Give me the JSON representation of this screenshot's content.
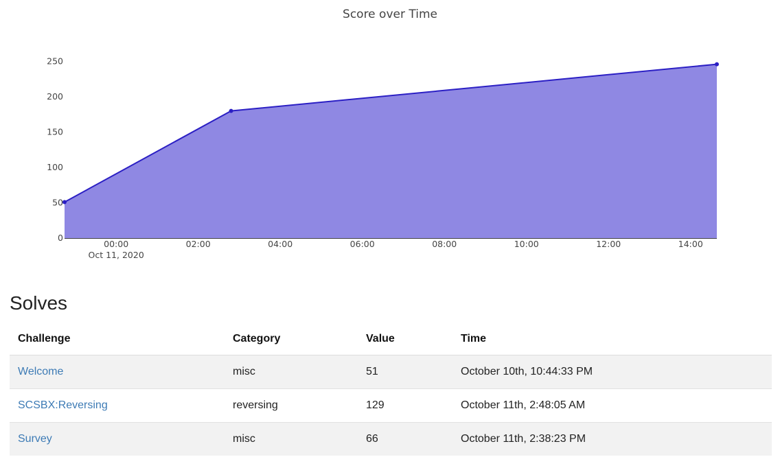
{
  "chart_data": {
    "type": "area",
    "title": "Score over Time",
    "xlabel": "",
    "ylabel": "",
    "x_axis": "time",
    "x": [
      "2020-10-10 22:44:33",
      "2020-10-11 02:48:05",
      "2020-10-11 14:38:23"
    ],
    "y": [
      51,
      180,
      246
    ],
    "xlim": [
      "2020-10-10 22:44:33",
      "2020-10-11 14:38:23"
    ],
    "ylim": [
      0,
      260
    ],
    "yticks": [
      0,
      50,
      100,
      150,
      200,
      250
    ],
    "xticks": [
      {
        "value": "2020-10-11 00:00",
        "label": "00:00",
        "sublabel": "Oct 11, 2020"
      },
      {
        "value": "2020-10-11 02:00",
        "label": "02:00",
        "sublabel": ""
      },
      {
        "value": "2020-10-11 04:00",
        "label": "04:00",
        "sublabel": ""
      },
      {
        "value": "2020-10-11 06:00",
        "label": "06:00",
        "sublabel": ""
      },
      {
        "value": "2020-10-11 08:00",
        "label": "08:00",
        "sublabel": ""
      },
      {
        "value": "2020-10-11 10:00",
        "label": "10:00",
        "sublabel": ""
      },
      {
        "value": "2020-10-11 12:00",
        "label": "12:00",
        "sublabel": ""
      },
      {
        "value": "2020-10-11 14:00",
        "label": "14:00",
        "sublabel": ""
      }
    ],
    "grid": false,
    "legend": "none",
    "line_color": "#2b1fc4",
    "fill_color": "#8f88e3"
  },
  "solves": {
    "heading": "Solves",
    "columns": [
      "Challenge",
      "Category",
      "Value",
      "Time"
    ],
    "rows": [
      {
        "challenge": "Welcome",
        "category": "misc",
        "value": "51",
        "time": "October 10th, 10:44:33 PM"
      },
      {
        "challenge": "SCSBX:Reversing",
        "category": "reversing",
        "value": "129",
        "time": "October 11th, 2:48:05 AM"
      },
      {
        "challenge": "Survey",
        "category": "misc",
        "value": "66",
        "time": "October 11th, 2:38:23 PM"
      }
    ]
  },
  "colors": {
    "link": "#3d7bb5",
    "row_stripe": "#f2f2f2"
  }
}
